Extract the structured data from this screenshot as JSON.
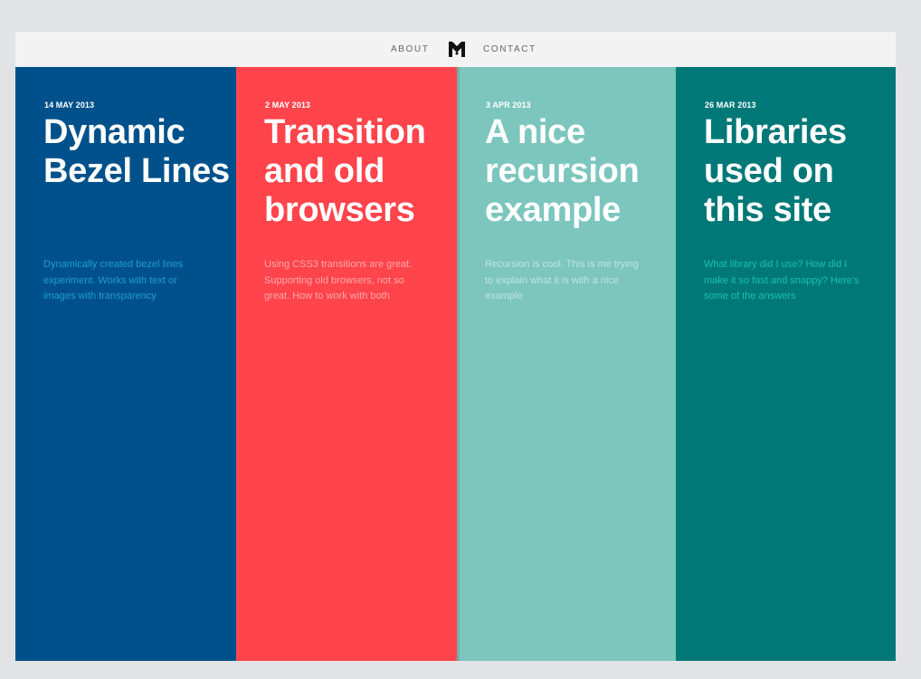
{
  "nav": {
    "about_label": "ABOUT",
    "contact_label": "CONTACT",
    "logo_icon": "m-monogram-logo-icon"
  },
  "posts": [
    {
      "date": "14 MAY 2013",
      "title": "Dynamic Bezel Lines",
      "excerpt": "Dynamically created bezel lines experiment. Works with text or images with transparency",
      "bg_color": "#00518b",
      "excerpt_color": "#1f9bd1"
    },
    {
      "date": "2 MAY 2013",
      "title": "Transition and old browsers",
      "excerpt": "Using CSS3 transitions are great. Supporting old browsers, not so great. How to work with both",
      "bg_color": "#ff444c",
      "excerpt_color": "#ffa7a7"
    },
    {
      "date": "3 APR 2013",
      "title": "A nice recursion example",
      "excerpt": "Recursion is cool. This is me trying to explain what it is with a nice example",
      "bg_color": "#7cc6be",
      "excerpt_color": "#bfe5e1"
    },
    {
      "date": "26 MAR 2013",
      "title": "Libraries used on this site",
      "excerpt": "What library did I use? How did I make it so fast and snappy? Here's some of the answers",
      "bg_color": "#007878",
      "excerpt_color": "#18bfb8"
    }
  ]
}
